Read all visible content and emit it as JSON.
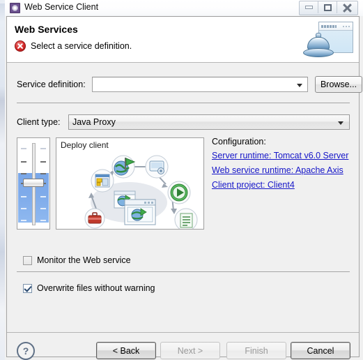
{
  "window": {
    "title": "Web Service Client",
    "icon": "gear-icon",
    "controls": {
      "minimize": "minimize-icon",
      "restore": "restore-icon",
      "close": "close-icon"
    }
  },
  "banner": {
    "title": "Web Services",
    "status_icon": "error-icon",
    "message": "Select a service definition.",
    "art": "web-service-dome-window-icon"
  },
  "form": {
    "service_definition": {
      "label": "Service definition:",
      "value": "",
      "placeholder": "",
      "dropdown_icon": "chevron-down-icon"
    },
    "browse_button": "Browse...",
    "client_type": {
      "label": "Client type:",
      "value": "Java Proxy",
      "dropdown_icon": "chevron-down-icon"
    }
  },
  "scale": {
    "name": "deployment-scale-slider",
    "value_position_pct": 47
  },
  "illustration": {
    "title": "Deploy client"
  },
  "configuration": {
    "title": "Configuration:",
    "links": [
      {
        "label": "Server runtime: Tomcat v6.0 Server",
        "name": "server-runtime-link"
      },
      {
        "label": "Web service runtime: Apache Axis",
        "name": "web-service-runtime-link"
      },
      {
        "label": "Client project: Client4",
        "name": "client-project-link"
      }
    ],
    "link_color": "#1515c8"
  },
  "options": [
    {
      "label": "Monitor the Web service",
      "checked": false,
      "name": "monitor-web-service-checkbox"
    },
    {
      "label": "Overwrite files without warning",
      "checked": true,
      "name": "overwrite-files-checkbox"
    }
  ],
  "buttons": {
    "help": "?",
    "back": "< Back",
    "next": "Next >",
    "finish": "Finish",
    "cancel": "Cancel",
    "next_enabled": false,
    "finish_enabled": false
  }
}
